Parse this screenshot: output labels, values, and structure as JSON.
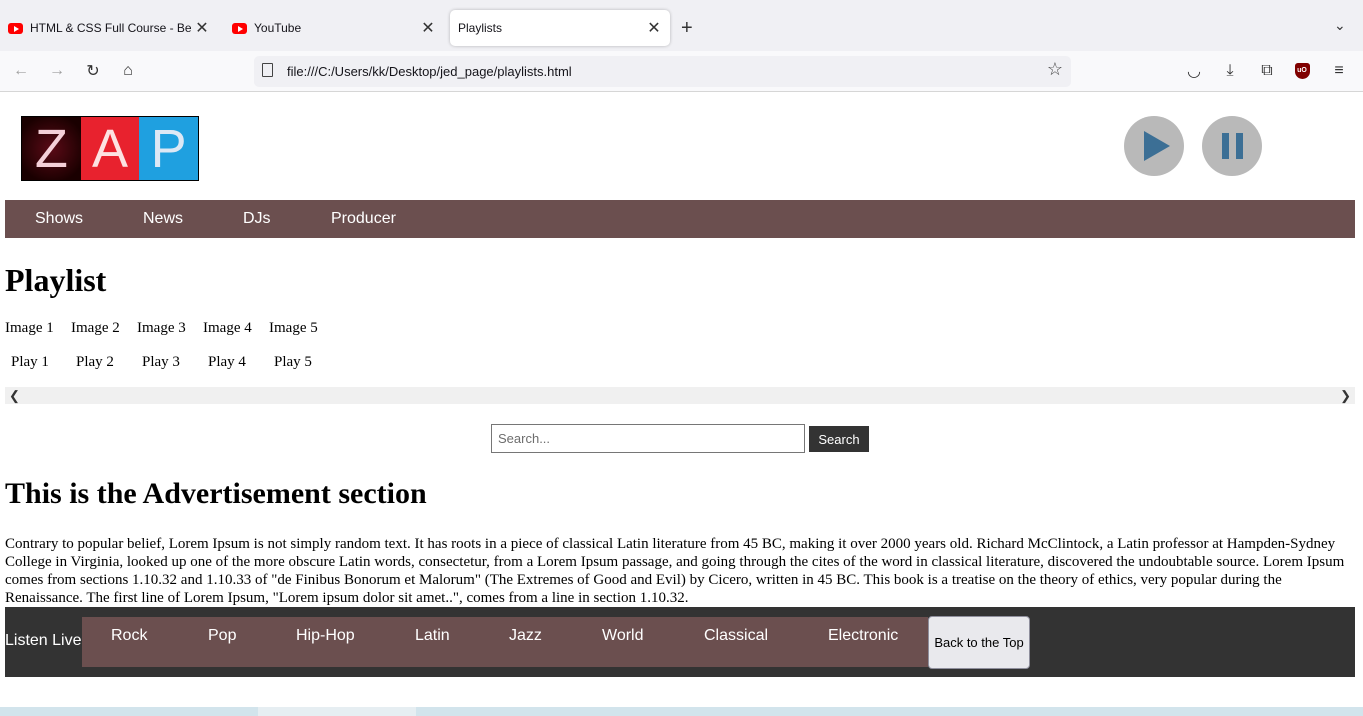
{
  "browser": {
    "tabs": [
      {
        "title": "HTML & CSS Full Course - Beginner to Pro",
        "active": false
      },
      {
        "title": "YouTube",
        "active": false
      },
      {
        "title": "Playlists",
        "active": true
      }
    ],
    "new_tab": "+",
    "tab_list": "⌄",
    "url": "file:///C:/Users/kk/Desktop/jed_page/playlists.html",
    "ublock": "uO"
  },
  "site": {
    "logo_letters": [
      "Z",
      "A",
      "P"
    ],
    "nav": [
      "Shows",
      "News",
      "DJs",
      "Producer"
    ],
    "playlist_title": "Playlist",
    "images": [
      "Image 1",
      "Image 2",
      "Image 3",
      "Image 4",
      "Image 5"
    ],
    "plays": [
      "Play 1",
      "Play 2",
      "Play 3",
      "Play 4",
      "Play 5"
    ],
    "search_placeholder": "Search...",
    "search_button": "Search",
    "ad_title": "This is the Advertisement section",
    "ad_text": "Contrary to popular belief, Lorem Ipsum is not simply random text. It has roots in a piece of classical Latin literature from 45 BC, making it over 2000 years old. Richard McClintock, a Latin professor at Hampden-Sydney College in Virginia, looked up one of the more obscure Latin words, consectetur, from a Lorem Ipsum passage, and going through the cites of the word in classical literature, discovered the undoubtable source. Lorem Ipsum comes from sections 1.10.32 and 1.10.33 of \"de Finibus Bonorum et Malorum\" (The Extremes of Good and Evil) by Cicero, written in 45 BC. This book is a treatise on the theory of ethics, very popular during the Renaissance. The first line of Lorem Ipsum, \"Lorem ipsum dolor sit amet..\", comes from a line in section 1.10.32.",
    "listen_live": "Listen Live",
    "genres": [
      "Rock",
      "Pop",
      "Hip-Hop",
      "Latin",
      "Jazz",
      "World",
      "Classical",
      "Electronic"
    ],
    "back_to_top": "Back to the Top"
  },
  "colors": {
    "nav_bg": "#6b4f4f",
    "footer_bg": "#333333",
    "player_button": "#b9b9b9",
    "player_icon": "#3c6f95"
  }
}
